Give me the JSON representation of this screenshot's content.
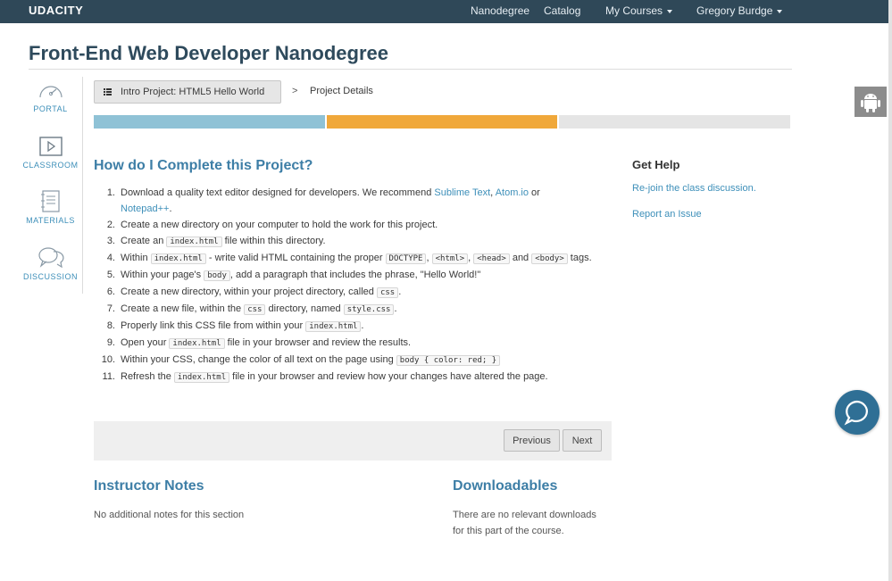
{
  "topnav": {
    "brand": "UDACITY",
    "links": {
      "nanodegree": "Nanodegree",
      "catalog": "Catalog",
      "my_courses": "My Courses",
      "user": "Gregory Burdge"
    }
  },
  "page": {
    "title": "Front-End Web Developer Nanodegree"
  },
  "sidebar": {
    "portal": "PORTAL",
    "classroom": "CLASSROOM",
    "materials": "MATERIALS",
    "discussion": "DISCUSSION"
  },
  "breadcrumb": {
    "lesson": "Intro Project: HTML5 Hello World",
    "separator": ">",
    "current": "Project Details"
  },
  "progress": {
    "colors": [
      "#8fc2d6",
      "#f0a83a",
      "#e5e5e5"
    ]
  },
  "main": {
    "heading": "How do I Complete this Project?",
    "steps": [
      {
        "num": "1.",
        "parts": [
          [
            "text",
            "Download a quality text editor designed for developers. We recommend "
          ],
          [
            "link",
            "Sublime Text"
          ],
          [
            "text",
            ", "
          ],
          [
            "link",
            "Atom.io"
          ],
          [
            "text",
            " or "
          ],
          [
            "link",
            "Notepad++"
          ],
          [
            "text",
            "."
          ]
        ]
      },
      {
        "num": "2.",
        "parts": [
          [
            "text",
            "Create a new directory on your computer to hold the work for this project."
          ]
        ]
      },
      {
        "num": "3.",
        "parts": [
          [
            "text",
            "Create an "
          ],
          [
            "code",
            "index.html"
          ],
          [
            "text",
            " file within this directory."
          ]
        ]
      },
      {
        "num": "4.",
        "parts": [
          [
            "text",
            "Within "
          ],
          [
            "code",
            "index.html"
          ],
          [
            "text",
            " - write valid HTML containing the proper "
          ],
          [
            "code",
            "DOCTYPE"
          ],
          [
            "text",
            ", "
          ],
          [
            "code",
            "<html>"
          ],
          [
            "text",
            ", "
          ],
          [
            "code",
            "<head>"
          ],
          [
            "text",
            " and "
          ],
          [
            "code",
            "<body>"
          ],
          [
            "text",
            " tags."
          ]
        ]
      },
      {
        "num": "5.",
        "parts": [
          [
            "text",
            "Within your page's "
          ],
          [
            "code",
            "body"
          ],
          [
            "text",
            ", add a paragraph that includes the phrase, \"Hello World!\""
          ]
        ]
      },
      {
        "num": "6.",
        "parts": [
          [
            "text",
            "Create a new directory, within your project directory, called "
          ],
          [
            "code",
            "css"
          ],
          [
            "text",
            "."
          ]
        ]
      },
      {
        "num": "7.",
        "parts": [
          [
            "text",
            "Create a new file, within the "
          ],
          [
            "code",
            "css"
          ],
          [
            "text",
            " directory, named "
          ],
          [
            "code",
            "style.css"
          ],
          [
            "text",
            "."
          ]
        ]
      },
      {
        "num": "8.",
        "parts": [
          [
            "text",
            "Properly link this CSS file from within your "
          ],
          [
            "code",
            "index.html"
          ],
          [
            "text",
            "."
          ]
        ]
      },
      {
        "num": "9.",
        "parts": [
          [
            "text",
            "Open your "
          ],
          [
            "code",
            "index.html"
          ],
          [
            "text",
            " file in your browser and review the results."
          ]
        ]
      },
      {
        "num": "10.",
        "parts": [
          [
            "text",
            "Within your CSS, change the color of all text on the page using "
          ],
          [
            "code",
            "body { color: red; }"
          ]
        ]
      },
      {
        "num": "11.",
        "parts": [
          [
            "text",
            "Refresh the "
          ],
          [
            "code",
            "index.html"
          ],
          [
            "text",
            " file in your browser and review how your changes have altered the page."
          ]
        ]
      }
    ]
  },
  "help": {
    "title": "Get Help",
    "rejoin": "Re-join the class discussion.",
    "report": "Report an Issue"
  },
  "pager": {
    "previous": "Previous",
    "next": "Next"
  },
  "instructor_notes": {
    "title": "Instructor Notes",
    "text": "No additional notes for this section"
  },
  "downloadables": {
    "title": "Downloadables",
    "line1": "There are no relevant downloads",
    "line2": "for this part of the course."
  },
  "icons": {
    "portal": "speedometer-icon",
    "classroom": "play-icon",
    "materials": "notebook-icon",
    "discussion": "chat-bubbles-icon",
    "android": "android-icon",
    "chat": "chat-icon"
  }
}
